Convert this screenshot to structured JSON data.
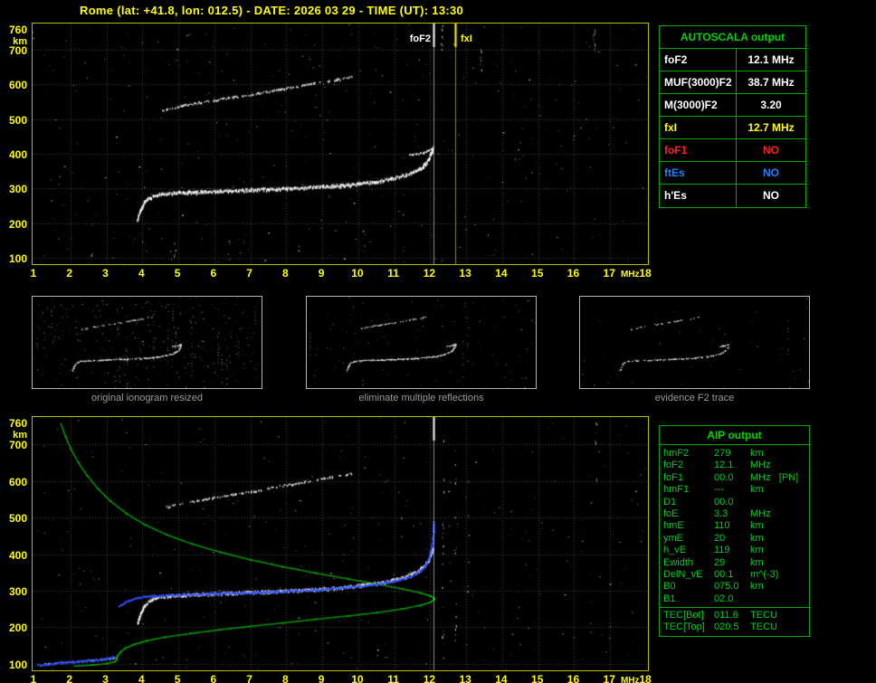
{
  "title": "Rome (lat: +41.8, lon: 012.5) - DATE: 2026 03 29 - TIME (UT): 13:30",
  "colors": {
    "background": "#000000",
    "axis_text": "#ffff00",
    "plot_border": "#b9b900",
    "grid": "#454545",
    "echo_trace": "#ffffff",
    "profile_green": "#00d800",
    "model_blue": "#3050ff",
    "table_border": "#00a800",
    "table_header_green": "#00d400",
    "caption_gray": "#9a9a9a",
    "foF2_marker": "#ffffff",
    "fxI_marker": "#ffff00",
    "foF1_red": "#ff2020",
    "ftEs_blue": "#2080ff"
  },
  "autoscala_table": {
    "header": "AUTOSCALA output",
    "rows": [
      {
        "label": "foF2",
        "value": "12.1 MHz",
        "color": "#ffffff"
      },
      {
        "label": "MUF(3000)F2",
        "value": "38.7 MHz",
        "color": "#ffffff"
      },
      {
        "label": "M(3000)F2",
        "value": "3.20",
        "color": "#ffffff"
      },
      {
        "label": "fxI",
        "value": "12.7 MHz",
        "color": "#ffff00"
      },
      {
        "label": "foF1",
        "value": "NO",
        "color": "#ff2020"
      },
      {
        "label": "ftEs",
        "value": "NO",
        "color": "#2080ff"
      },
      {
        "label": "h'Es",
        "value": "NO",
        "color": "#ffffff"
      }
    ]
  },
  "aip_table": {
    "header": "AIP output",
    "rows": [
      {
        "name": "hmF2",
        "value": "279",
        "unit": "km"
      },
      {
        "name": "foF2",
        "value": "12.1",
        "unit": "MHz"
      },
      {
        "name": "foF1",
        "value": "00.0",
        "unit": "MHz   [PN]"
      },
      {
        "name": "hmF1",
        "value": "---",
        "unit": "km"
      },
      {
        "name": "D1",
        "value": "00.0",
        "unit": ""
      },
      {
        "name": "foE",
        "value": "3.3",
        "unit": "MHz"
      },
      {
        "name": "hmE",
        "value": "110",
        "unit": "km"
      },
      {
        "name": "ymE",
        "value": "20",
        "unit": "km"
      },
      {
        "name": "h_vE",
        "value": "119",
        "unit": "km"
      },
      {
        "name": "Ewidth",
        "value": "29",
        "unit": "km"
      },
      {
        "name": "DelN_vE",
        "value": "00.1",
        "unit": "m^(-3)"
      },
      {
        "name": "B0",
        "value": "075.0",
        "unit": "km"
      },
      {
        "name": "B1",
        "value": "02.0",
        "unit": ""
      }
    ],
    "tec_rows": [
      {
        "name": "TEC[Bot]",
        "value": "011.6",
        "unit": "TECU"
      },
      {
        "name": "TEC[Top]",
        "value": "020.5",
        "unit": "TECU"
      }
    ]
  },
  "thumbnails": [
    {
      "caption": "original ionogram resized"
    },
    {
      "caption": "eliminate multiple reflections"
    },
    {
      "caption": "evidence F2 trace"
    }
  ],
  "chart_data": [
    {
      "id": "scaled_ionogram",
      "type": "scatter",
      "title": "",
      "xlabel": "MHz",
      "ylabel": "km",
      "xlim": [
        1,
        18
      ],
      "ylim": [
        85,
        772
      ],
      "x_ticks": [
        1,
        2,
        3,
        4,
        5,
        6,
        7,
        8,
        9,
        10,
        11,
        12,
        13,
        14,
        15,
        16,
        17,
        18
      ],
      "y_ticks": [
        100,
        200,
        300,
        400,
        500,
        600,
        700,
        760
      ],
      "grid": true,
      "markers": [
        {
          "label": "foF2",
          "x": 12.1,
          "color": "#ffffff"
        },
        {
          "label": "fxI",
          "x": 12.7,
          "color": "#ffff00"
        }
      ],
      "series": [
        {
          "name": "F2-echo-trace",
          "color": "#ffffff",
          "style": "echo",
          "thickness": 3.4,
          "density": 1.0,
          "points": [
            [
              3.85,
              210
            ],
            [
              3.95,
              238
            ],
            [
              4.05,
              258
            ],
            [
              4.2,
              272
            ],
            [
              4.45,
              281
            ],
            [
              5.0,
              286
            ],
            [
              5.5,
              288
            ],
            [
              6.0,
              290
            ],
            [
              6.5,
              292
            ],
            [
              7.0,
              294
            ],
            [
              7.5,
              296
            ],
            [
              8.0,
              298
            ],
            [
              8.5,
              300
            ],
            [
              9.0,
              303
            ],
            [
              9.5,
              307
            ],
            [
              10.0,
              312
            ],
            [
              10.5,
              318
            ],
            [
              10.9,
              326
            ],
            [
              11.3,
              336
            ],
            [
              11.6,
              349
            ],
            [
              11.8,
              363
            ],
            [
              11.95,
              382
            ],
            [
              12.02,
              400
            ],
            [
              12.06,
              414
            ]
          ]
        },
        {
          "name": "F2-cusp",
          "color": "#ffffff",
          "style": "echo",
          "thickness": 2,
          "density": 0.75,
          "points": [
            [
              12.05,
              412
            ],
            [
              11.92,
              407
            ],
            [
              11.78,
              402
            ],
            [
              11.6,
              398
            ],
            [
              11.42,
              396
            ]
          ]
        },
        {
          "name": "second-hop",
          "color": "#ffffff",
          "style": "echo",
          "thickness": 2.2,
          "density": 0.5,
          "points": [
            [
              4.55,
              524
            ],
            [
              5.0,
              535
            ],
            [
              5.5,
              545
            ],
            [
              6.0,
              553
            ],
            [
              6.5,
              561
            ],
            [
              7.0,
              569
            ],
            [
              7.5,
              578
            ],
            [
              8.0,
              587
            ],
            [
              8.5,
              596
            ],
            [
              9.0,
              605
            ],
            [
              9.4,
              612
            ],
            [
              9.8,
              620
            ]
          ]
        }
      ],
      "noise": {
        "dots": 520,
        "columns": [
          {
            "x": 12.32,
            "km": [
              700,
              770
            ],
            "density": 0.8
          },
          {
            "x": 16.55,
            "km": [
              690,
              768
            ],
            "density": 0.7
          },
          {
            "x": 13.4,
            "km": [
              640,
              700
            ],
            "density": 0.3
          },
          {
            "x": 2.6,
            "km": [
              90,
              200
            ],
            "density": 0.15
          },
          {
            "x": 4.9,
            "km": [
              90,
              160
            ],
            "density": 0.18
          },
          {
            "x": 6.4,
            "km": [
              95,
              150
            ],
            "density": 0.2
          },
          {
            "x": 10.15,
            "km": [
              90,
              200
            ],
            "density": 0.15
          }
        ]
      }
    },
    {
      "id": "aip_ionogram",
      "type": "scatter",
      "title": "",
      "xlabel": "MHz",
      "ylabel": "km",
      "xlim": [
        1,
        18
      ],
      "ylim": [
        85,
        772
      ],
      "x_ticks": [
        1,
        2,
        3,
        4,
        5,
        6,
        7,
        8,
        9,
        10,
        11,
        12,
        13,
        14,
        15,
        16,
        17,
        18
      ],
      "y_ticks": [
        100,
        200,
        300,
        400,
        500,
        600,
        700,
        760
      ],
      "grid": true,
      "markers": [
        {
          "label": "",
          "x": 12.1,
          "color": "#ffffff"
        }
      ],
      "series": [
        {
          "name": "F2-echo-trace",
          "color": "#ffffff",
          "style": "echo",
          "thickness": 3.2,
          "density": 0.95,
          "points": [
            [
              3.85,
              210
            ],
            [
              3.95,
              238
            ],
            [
              4.05,
              258
            ],
            [
              4.2,
              272
            ],
            [
              4.45,
              281
            ],
            [
              5.0,
              286
            ],
            [
              5.5,
              288
            ],
            [
              6.0,
              290
            ],
            [
              6.5,
              292
            ],
            [
              7.0,
              294
            ],
            [
              7.5,
              296
            ],
            [
              8.0,
              298
            ],
            [
              8.5,
              300
            ],
            [
              9.0,
              303
            ],
            [
              9.5,
              307
            ],
            [
              10.0,
              312
            ],
            [
              10.5,
              318
            ],
            [
              10.9,
              326
            ],
            [
              11.3,
              336
            ],
            [
              11.6,
              349
            ],
            [
              11.8,
              363
            ],
            [
              11.95,
              382
            ],
            [
              12.02,
              400
            ],
            [
              12.06,
              414
            ]
          ]
        },
        {
          "name": "second-hop",
          "color": "#ffffff",
          "style": "echo",
          "thickness": 2.2,
          "density": 0.45,
          "points": [
            [
              4.55,
              524
            ],
            [
              5.0,
              535
            ],
            [
              5.5,
              545
            ],
            [
              6.0,
              553
            ],
            [
              6.5,
              561
            ],
            [
              7.0,
              569
            ],
            [
              7.5,
              578
            ],
            [
              8.0,
              587
            ],
            [
              8.5,
              596
            ],
            [
              9.0,
              605
            ],
            [
              9.4,
              612
            ],
            [
              9.8,
              620
            ]
          ]
        },
        {
          "name": "E-echo",
          "color": "#ffffff",
          "style": "echo",
          "thickness": 1.8,
          "density": 0.4,
          "points": [
            [
              1.25,
              99
            ],
            [
              1.7,
              102
            ],
            [
              2.2,
              105
            ],
            [
              2.7,
              109
            ],
            [
              3.05,
              113
            ],
            [
              3.25,
              117
            ]
          ]
        },
        {
          "name": "Ne-profile-topside",
          "color": "#00d800",
          "style": "dots",
          "density": 1,
          "points": [
            [
              1.72,
              758
            ],
            [
              1.85,
              722
            ],
            [
              2.0,
              688
            ],
            [
              2.2,
              652
            ],
            [
              2.45,
              616
            ],
            [
              2.75,
              580
            ],
            [
              3.1,
              546
            ],
            [
              3.55,
              512
            ],
            [
              4.05,
              482
            ],
            [
              4.65,
              455
            ],
            [
              5.35,
              430
            ],
            [
              6.15,
              407
            ],
            [
              7.0,
              386
            ],
            [
              7.9,
              367
            ],
            [
              8.8,
              350
            ],
            [
              9.7,
              334
            ],
            [
              10.5,
              320
            ],
            [
              11.2,
              307
            ],
            [
              11.7,
              296
            ],
            [
              12.0,
              287
            ],
            [
              12.1,
              280
            ]
          ]
        },
        {
          "name": "Ne-profile-bottomside",
          "color": "#00d800",
          "style": "dots",
          "density": 1,
          "points": [
            [
              12.1,
              279
            ],
            [
              12.0,
              271
            ],
            [
              11.7,
              262
            ],
            [
              11.2,
              252
            ],
            [
              10.5,
              242
            ],
            [
              9.7,
              233
            ],
            [
              8.8,
              224
            ],
            [
              7.9,
              214
            ],
            [
              7.0,
              205
            ],
            [
              6.1,
              195
            ],
            [
              5.3,
              185
            ],
            [
              4.6,
              175
            ],
            [
              4.1,
              165
            ],
            [
              3.75,
              155
            ],
            [
              3.5,
              145
            ],
            [
              3.38,
              135
            ],
            [
              3.3,
              125
            ],
            [
              3.27,
              115
            ],
            [
              3.22,
              108
            ],
            [
              3.0,
              103
            ],
            [
              2.6,
              99
            ],
            [
              2.1,
              96
            ]
          ]
        },
        {
          "name": "AIP-model-F2-trace",
          "color": "#3050ff",
          "style": "model",
          "density": 1,
          "points": [
            [
              3.35,
              256
            ],
            [
              3.6,
              272
            ],
            [
              3.9,
              280
            ],
            [
              4.3,
              285
            ],
            [
              5.0,
              288
            ],
            [
              6.0,
              291
            ],
            [
              7.0,
              294
            ],
            [
              8.0,
              298
            ],
            [
              9.0,
              303
            ],
            [
              9.8,
              309
            ],
            [
              10.5,
              317
            ],
            [
              11.0,
              326
            ],
            [
              11.45,
              338
            ],
            [
              11.75,
              355
            ],
            [
              11.92,
              375
            ],
            [
              12.0,
              398
            ],
            [
              12.07,
              430
            ],
            [
              12.1,
              462
            ],
            [
              12.1,
              486
            ]
          ]
        },
        {
          "name": "AIP-model-E-trace",
          "color": "#3050ff",
          "style": "model",
          "density": 1,
          "points": [
            [
              1.1,
              96
            ],
            [
              1.6,
              101
            ],
            [
              2.1,
              105
            ],
            [
              2.6,
              109
            ],
            [
              3.0,
              113
            ],
            [
              3.22,
              118
            ]
          ]
        }
      ],
      "noise": {
        "dots": 420,
        "columns": [
          {
            "x": 12.35,
            "km": [
              100,
              760
            ],
            "density": 0.12
          },
          {
            "x": 12.7,
            "km": [
              100,
              740
            ],
            "density": 0.1
          },
          {
            "x": 13.05,
            "km": [
              250,
              700
            ],
            "density": 0.08
          },
          {
            "x": 16.6,
            "km": [
              600,
              760
            ],
            "density": 0.3
          },
          {
            "x": 11.2,
            "km": [
              430,
              520
            ],
            "density": 0.15
          }
        ]
      }
    }
  ]
}
